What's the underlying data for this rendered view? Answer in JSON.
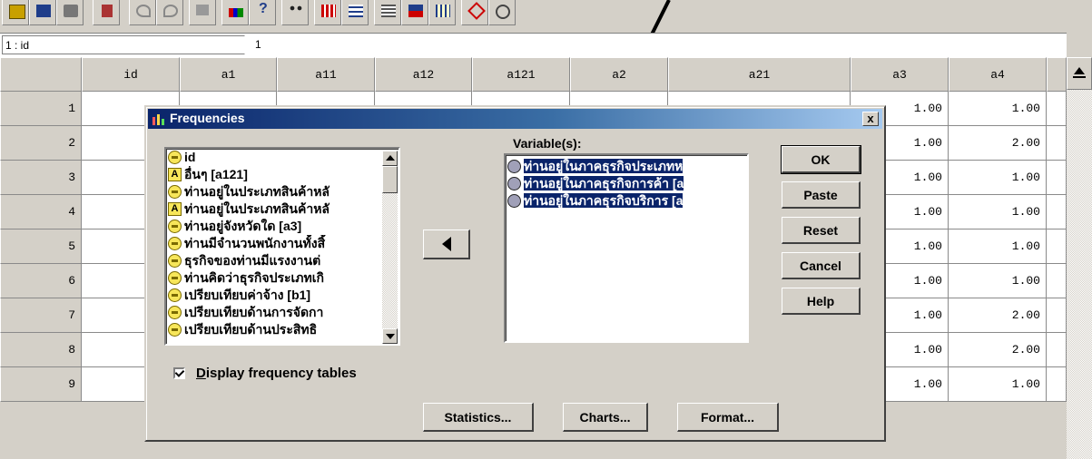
{
  "toolbar": {
    "icons": [
      "open-icon",
      "save-icon",
      "print-icon",
      "dialog-recall-icon",
      "undo-icon",
      "redo-icon",
      "goto-chart-icon",
      "goto-case-icon",
      "variables-icon",
      "find-icon",
      "insert-case-icon",
      "insert-variable-icon",
      "split-file-icon",
      "weight-cases-icon",
      "select-cases-icon",
      "value-labels-icon",
      "use-sets-icon"
    ]
  },
  "cell_editor": {
    "ref": "1 : id",
    "value": "1"
  },
  "grid": {
    "columns": [
      "id",
      "a1",
      "a11",
      "a12",
      "a121",
      "a2",
      "a21",
      "a3",
      "a4"
    ],
    "rows": [
      {
        "num": "1",
        "a3": "1.00",
        "a4": "1.00"
      },
      {
        "num": "2",
        "a3": "1.00",
        "a4": "2.00"
      },
      {
        "num": "3",
        "a3": "1.00",
        "a4": "1.00"
      },
      {
        "num": "4",
        "a3": "1.00",
        "a4": "1.00"
      },
      {
        "num": "5",
        "a3": "1.00",
        "a4": "1.00"
      },
      {
        "num": "6",
        "a3": "1.00",
        "a4": "1.00"
      },
      {
        "num": "7",
        "a3": "1.00",
        "a4": "2.00"
      },
      {
        "num": "8",
        "a3": "1.00",
        "a4": "2.00"
      },
      {
        "num": "9",
        "a3": "1.00",
        "a4": "1.00"
      }
    ]
  },
  "dialog": {
    "title": "Frequencies",
    "close_label": "x",
    "source_vars": [
      {
        "type": "scale",
        "label": "id"
      },
      {
        "type": "string",
        "label": "อื่นๆ [a121]"
      },
      {
        "type": "scale",
        "label": "ท่านอยู่ในประเภทสินค้าหลั"
      },
      {
        "type": "string",
        "label": "ท่านอยู่ในประเภทสินค้าหลั"
      },
      {
        "type": "scale",
        "label": "ท่านอยู่จังหวัดใด [a3]"
      },
      {
        "type": "scale",
        "label": "ท่านมีจำนวนพนักงานทั้งสิ้"
      },
      {
        "type": "scale",
        "label": "ธุรกิจของท่านมีแรงงานต่"
      },
      {
        "type": "scale",
        "label": "ท่านคิดว่าธุรกิจประเภทเกิ"
      },
      {
        "type": "scale",
        "label": "เปรียบเทียบค่าจ้าง [b1]"
      },
      {
        "type": "scale",
        "label": "เปรียบเทียบด้านการจัดกา"
      },
      {
        "type": "scale",
        "label": "เปรียบเทียบด้านประสิทธิ"
      }
    ],
    "variables_label": "Variable(s):",
    "selected_vars": [
      "ท่านอยู่ในภาคธุรกิจประเภทห",
      "ท่านอยู่ในภาคธุรกิจการค้า [a",
      "ท่านอยู่ในภาคธุรกิจบริการ [a"
    ],
    "buttons": {
      "ok": "OK",
      "paste": "Paste",
      "reset": "Reset",
      "cancel": "Cancel",
      "help": "Help",
      "statistics": "Statistics...",
      "charts": "Charts...",
      "format": "Format..."
    },
    "display_tables_label": "Display frequency tables"
  }
}
